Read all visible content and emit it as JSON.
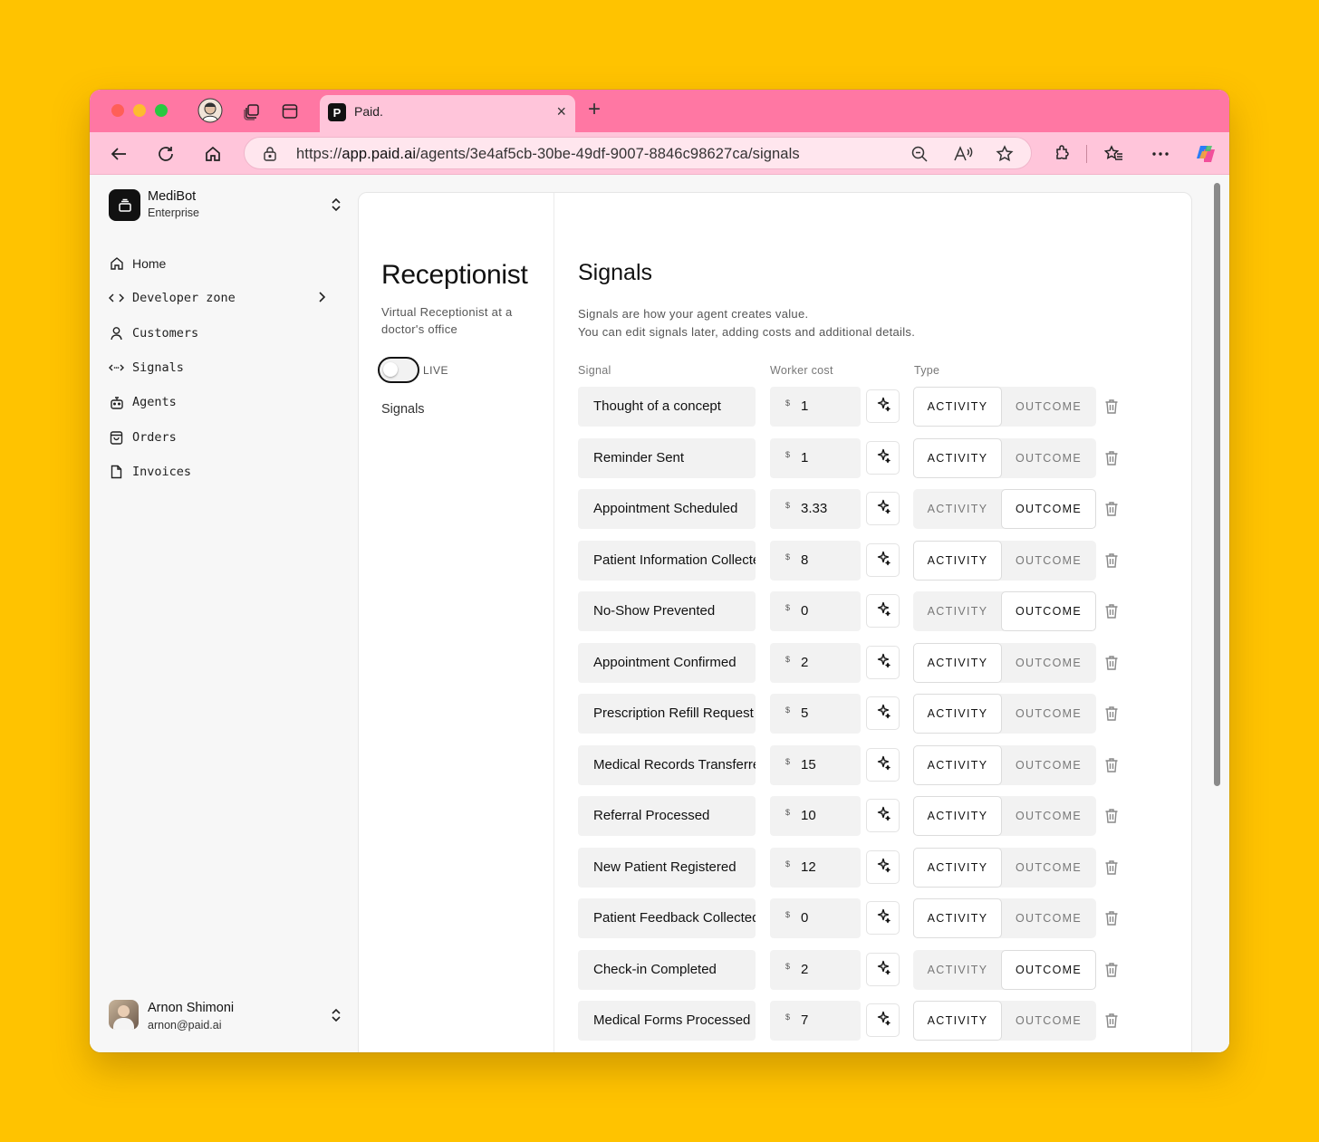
{
  "browser": {
    "tab_title": "Paid.",
    "tab_favicon": "P",
    "url_prefix": "https://",
    "url_host": "app.paid.ai",
    "url_path": "/agents/3e4af5cb-30be-49df-9007-8846c98627ca/signals",
    "colors": {
      "tabbar": "#FF77A3",
      "toolbar": "#FFC5DA",
      "background": "#FFC300"
    }
  },
  "sidebar": {
    "org_name": "MediBot",
    "org_plan": "Enterprise",
    "items": [
      {
        "label": "Home",
        "icon": "home-icon"
      },
      {
        "label": "Developer zone",
        "icon": "code-icon"
      },
      {
        "label": "Customers",
        "icon": "user-icon"
      },
      {
        "label": "Signals",
        "icon": "signal-arrows-icon"
      },
      {
        "label": "Agents",
        "icon": "bot-icon"
      },
      {
        "label": "Orders",
        "icon": "shopping-bag-icon"
      },
      {
        "label": "Invoices",
        "icon": "file-icon"
      }
    ],
    "user_name": "Arnon Shimoni",
    "user_email": "arnon@paid.ai"
  },
  "agent": {
    "title": "Receptionist",
    "description": "Virtual Receptionist at a doctor's office",
    "status_label": "LIVE",
    "live": false,
    "subnav_link": "Signals"
  },
  "signals": {
    "title": "Signals",
    "description_line1": "Signals are how your agent creates value.",
    "description_line2": "You can edit signals later, adding costs and additional details.",
    "col_signal": "Signal",
    "col_cost": "Worker cost",
    "col_type": "Type",
    "currency": "$",
    "activity_label": "ACTIVITY",
    "outcome_label": "OUTCOME",
    "rows": [
      {
        "name": "Thought of a concept",
        "cost": "1",
        "type": "activity"
      },
      {
        "name": "Reminder Sent",
        "cost": "1",
        "type": "activity"
      },
      {
        "name": "Appointment Scheduled",
        "cost": "3.33",
        "type": "outcome"
      },
      {
        "name": "Patient Information Collected",
        "cost": "8",
        "type": "activity"
      },
      {
        "name": "No-Show Prevented",
        "cost": "0",
        "type": "outcome"
      },
      {
        "name": "Appointment Confirmed",
        "cost": "2",
        "type": "activity"
      },
      {
        "name": "Prescription Refill Request",
        "cost": "5",
        "type": "activity"
      },
      {
        "name": "Medical Records Transferred",
        "cost": "15",
        "type": "activity"
      },
      {
        "name": "Referral Processed",
        "cost": "10",
        "type": "activity"
      },
      {
        "name": "New Patient Registered",
        "cost": "12",
        "type": "activity"
      },
      {
        "name": "Patient Feedback Collected",
        "cost": "0",
        "type": "activity"
      },
      {
        "name": "Check-in Completed",
        "cost": "2",
        "type": "outcome"
      },
      {
        "name": "Medical Forms Processed",
        "cost": "7",
        "type": "activity"
      }
    ]
  }
}
